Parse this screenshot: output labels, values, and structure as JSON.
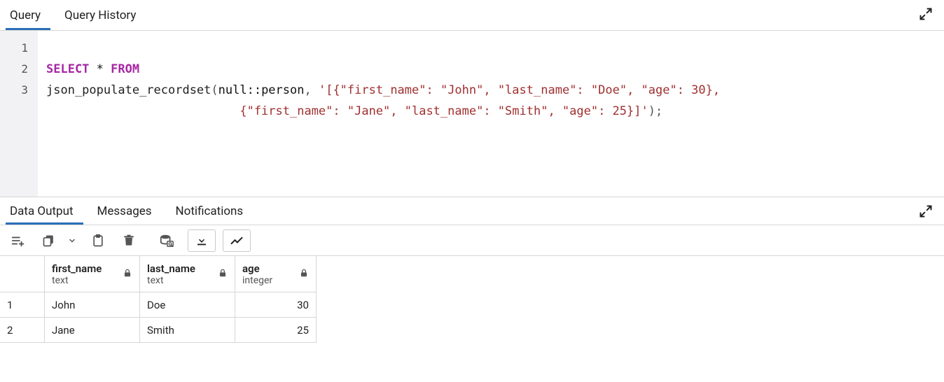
{
  "top_tabs": {
    "query": "Query",
    "history": "Query History"
  },
  "editor": {
    "line_numbers": [
      "1",
      "2",
      "3"
    ],
    "l1": {
      "kw_select": "SELECT",
      "star": " * ",
      "kw_from": "FROM"
    },
    "l2": {
      "func": "json_populate_recordset",
      "open": "(",
      "cast": "null::person",
      "comma": ", ",
      "str": "'[{\"first_name\": \"John\", \"last_name\": \"Doe\", \"age\": 30},"
    },
    "l3": {
      "indent": "                           ",
      "str": "{\"first_name\": \"Jane\", \"last_name\": \"Smith\", \"age\": 25}]'",
      "close": ");"
    }
  },
  "result_tabs": {
    "data": "Data Output",
    "messages": "Messages",
    "notifications": "Notifications"
  },
  "columns": [
    {
      "name": "first_name",
      "type": "text"
    },
    {
      "name": "last_name",
      "type": "text"
    },
    {
      "name": "age",
      "type": "integer"
    }
  ],
  "rows": [
    {
      "num": "1",
      "first_name": "John",
      "last_name": "Doe",
      "age": "30"
    },
    {
      "num": "2",
      "first_name": "Jane",
      "last_name": "Smith",
      "age": "25"
    }
  ]
}
